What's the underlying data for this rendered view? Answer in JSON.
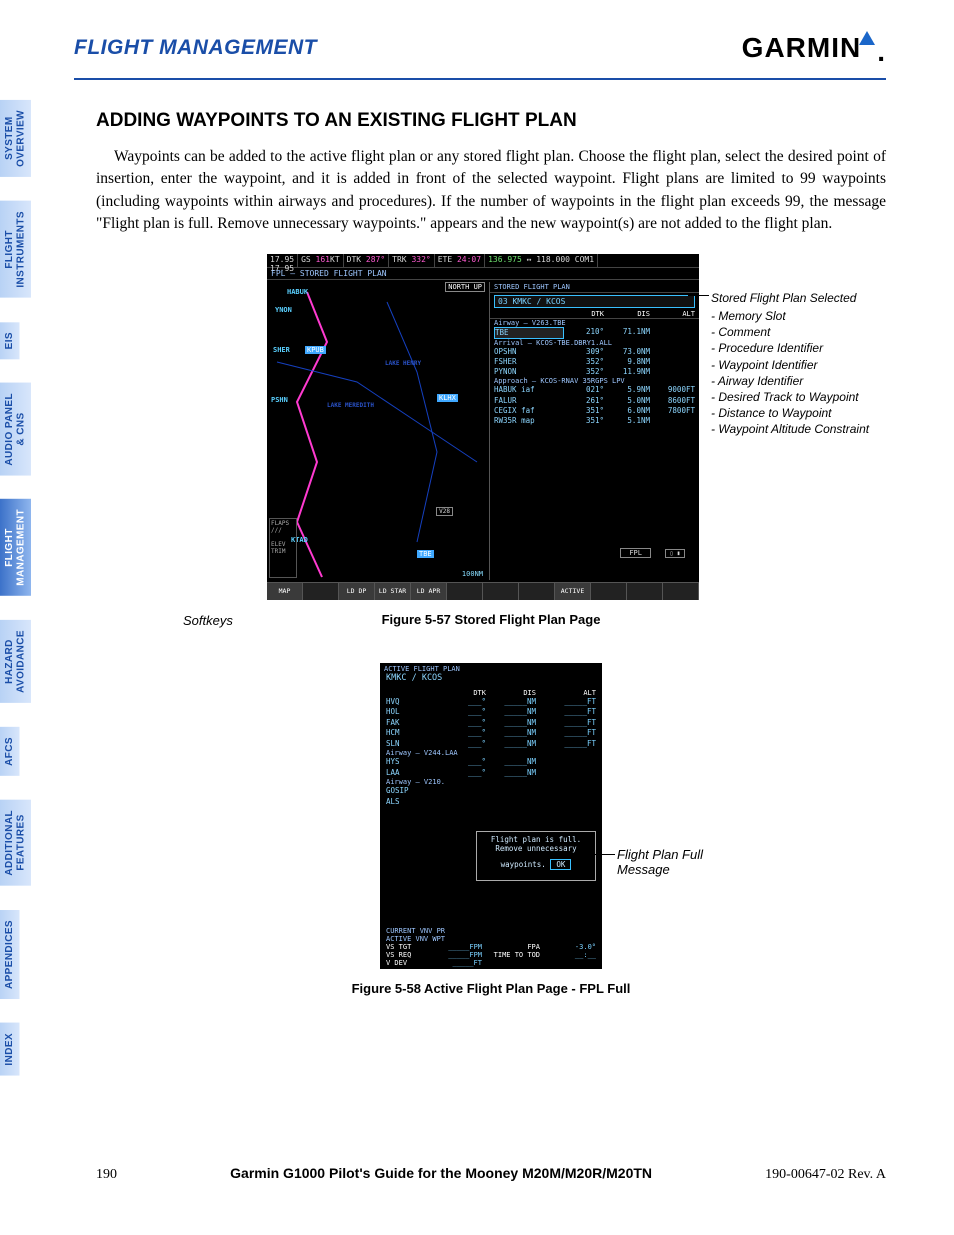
{
  "header": {
    "section": "FLIGHT MANAGEMENT",
    "brand": "GARMIN"
  },
  "tabs": [
    {
      "id": "system-overview",
      "label": "SYSTEM\nOVERVIEW",
      "active": false
    },
    {
      "id": "flight-instruments",
      "label": "FLIGHT\nINSTRUMENTS",
      "active": false
    },
    {
      "id": "eis",
      "label": "EIS",
      "active": false
    },
    {
      "id": "audio-panel-cns",
      "label": "AUDIO PANEL\n& CNS",
      "active": false
    },
    {
      "id": "flight-management",
      "label": "FLIGHT\nMANAGEMENT",
      "active": true
    },
    {
      "id": "hazard-avoidance",
      "label": "HAZARD\nAVOIDANCE",
      "active": false
    },
    {
      "id": "afcs",
      "label": "AFCS",
      "active": false
    },
    {
      "id": "additional-features",
      "label": "ADDITIONAL\nFEATURES",
      "active": false
    },
    {
      "id": "appendices",
      "label": "APPENDICES",
      "active": false
    },
    {
      "id": "index",
      "label": "INDEX",
      "active": false
    }
  ],
  "article": {
    "heading": "ADDING WAYPOINTS TO AN EXISTING FLIGHT PLAN",
    "body": "Waypoints can be added to the active flight plan or any stored flight plan.  Choose the flight plan, select the desired point of insertion, enter the waypoint, and it is added in front of the selected waypoint.  Flight plans are limited to 99 waypoints (including waypoints within airways and procedures). If the number of waypoints in the flight plan exceeds 99, the message \"Flight plan is full. Remove unnecessary waypoints.\" appears and the new waypoint(s) are not added to the flight plan."
  },
  "fig57": {
    "topbar": {
      "freq1a": "17.95",
      "freq1b": "17.95",
      "gs": "161",
      "gs_unit": "KT",
      "dtk": "287°",
      "trk": "332°",
      "ete": "24:07",
      "com_a": "136.975",
      "com_b": "118.000",
      "com_c": "136.975",
      "com_d": "118.000"
    },
    "title": "FPL – STORED FLIGHT PLAN",
    "northup": "NORTH UP",
    "map_labels": [
      "HABUK",
      "YNON",
      "SHER",
      "KPUB",
      "PSHN",
      "KTAD",
      "TBE",
      "V28",
      "KLHX"
    ],
    "map_small": [
      "LAKE HENRY",
      "LAKE MEREDITH"
    ],
    "scale": "100NM",
    "gauges": [
      "FLAPS",
      "ELEV\nTRIM"
    ],
    "gauge_label": "V28",
    "sfp_title": "STORED FLIGHT PLAN",
    "sfp_name": "03  KMKC / KCOS",
    "cols": [
      "",
      "DTK",
      "DIS",
      "ALT"
    ],
    "sections": [
      {
        "sec": "Airway – V263.TBE",
        "rows": [
          {
            "wpt": "TBE",
            "dtk": "210°",
            "dis": "71.1NM",
            "alt": ""
          }
        ]
      },
      {
        "sec": "Arrival – KCOS-TBE.DBRY1.ALL",
        "rows": [
          {
            "wpt": "OPSHN",
            "dtk": "309°",
            "dis": "73.0NM",
            "alt": ""
          },
          {
            "wpt": "FSHER",
            "dtk": "352°",
            "dis": "9.8NM",
            "alt": ""
          },
          {
            "wpt": "PYNON",
            "dtk": "352°",
            "dis": "11.9NM",
            "alt": ""
          }
        ]
      },
      {
        "sec": "Approach – KCOS-RNAV 35RGPS LPV",
        "rows": [
          {
            "wpt": "HABUK iaf",
            "dtk": "021°",
            "dis": "5.9NM",
            "alt": "9000FT"
          },
          {
            "wpt": "FALUR",
            "dtk": "261°",
            "dis": "5.0NM",
            "alt": "8600FT"
          },
          {
            "wpt": "CEGIX faf",
            "dtk": "351°",
            "dis": "6.0NM",
            "alt": "7800FT"
          },
          {
            "wpt": "RW35R map",
            "dtk": "351°",
            "dis": "5.1NM",
            "alt": ""
          }
        ]
      }
    ],
    "fpl_box": "FPL",
    "softkeys": [
      "MAP",
      "",
      "LD DP",
      "LD STAR",
      "LD APR",
      "",
      "",
      "",
      "ACTIVE",
      "",
      "",
      ""
    ],
    "softkeys_label": "Softkeys",
    "callout_title": "Stored Flight Plan Selected",
    "callout_items": [
      "Memory Slot",
      "Comment",
      "Procedure Identifier",
      "Waypoint Identifier",
      "Airway Identifier",
      "Desired Track to Waypoint",
      "Distance to Waypoint",
      "Waypoint Altitude Constraint"
    ],
    "caption": "Figure 5-57  Stored Flight Plan Page"
  },
  "fig58": {
    "title": "ACTIVE FLIGHT PLAN",
    "name": "KMKC / KCOS",
    "cols": [
      "",
      "DTK",
      "DIS",
      "ALT"
    ],
    "rows1": [
      {
        "wpt": "HVQ",
        "dtk": "___°",
        "dis": "_____NM",
        "alt": "_____FT"
      },
      {
        "wpt": "HOL",
        "dtk": "___°",
        "dis": "_____NM",
        "alt": "_____FT"
      },
      {
        "wpt": "FAK",
        "dtk": "___°",
        "dis": "_____NM",
        "alt": "_____FT"
      },
      {
        "wpt": "HCM",
        "dtk": "___°",
        "dis": "_____NM",
        "alt": "_____FT"
      },
      {
        "wpt": "SLN",
        "dtk": "___°",
        "dis": "_____NM",
        "alt": "_____FT"
      }
    ],
    "sec1": "Airway – V244.LAA",
    "rows2": [
      {
        "wpt": "HYS",
        "dtk": "___°",
        "dis": "_____NM",
        "alt": ""
      },
      {
        "wpt": "LAA",
        "dtk": "___°",
        "dis": "_____NM",
        "alt": ""
      }
    ],
    "sec2": "Airway – V210.",
    "rows3": [
      {
        "wpt": "GOSIP",
        "dtk": "",
        "dis": "",
        "alt": ""
      },
      {
        "wpt": "ALS",
        "dtk": "",
        "dis": "",
        "alt": ""
      }
    ],
    "msg": "Flight plan is full. Remove unnecessary waypoints.",
    "ok": "OK",
    "vnv_sec1": "CURRENT VNV PR",
    "vnv_sec2": "ACTIVE VNV WPT",
    "vnv_rows": [
      [
        "VS TGT",
        "_____FPM",
        "FPA",
        "-3.0°"
      ],
      [
        "VS REQ",
        "_____FPM",
        "TIME TO TOD",
        "__:__"
      ],
      [
        "V DEV",
        "_____FT",
        "",
        ""
      ]
    ],
    "callout": "Flight Plan Full Message",
    "caption": "Figure 5-58  Active Flight Plan Page - FPL Full"
  },
  "footer": {
    "page": "190",
    "mid": "Garmin G1000 Pilot's Guide for the Mooney M20M/M20R/M20TN",
    "rev": "190-00647-02   Rev. A"
  }
}
